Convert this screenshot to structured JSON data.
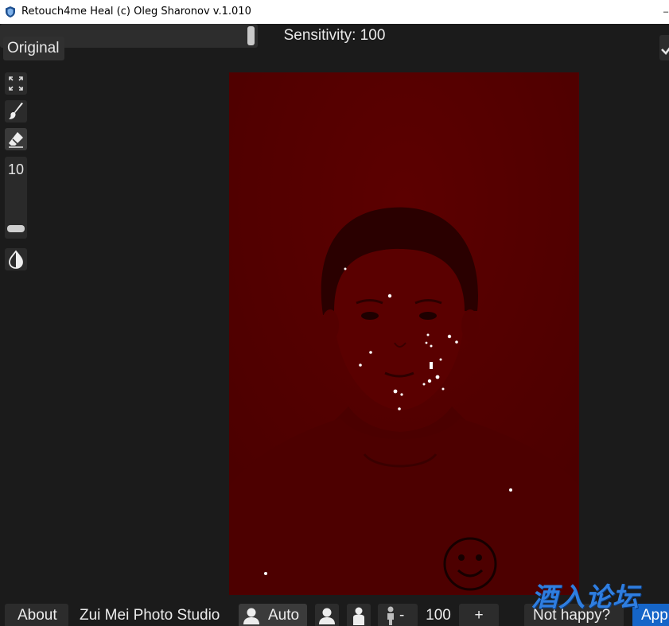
{
  "titlebar": {
    "title": "Retouch4me Heal (c) Oleg Sharonov v.1.010",
    "app_icon": "shield-icon"
  },
  "top": {
    "original_label": "Original",
    "sensitivity_label": "Sensitivity: 100",
    "sensitivity_value": 100,
    "confirm_icon": "check-icon"
  },
  "tools": {
    "fit_icon": "fit-to-screen-icon",
    "brush_icon": "brush-icon",
    "eraser_icon": "eraser-icon",
    "brush_size": "10",
    "mask_icon": "contrast-icon"
  },
  "colors": {
    "background": "#1b1b1b",
    "button": "#2c2c2c",
    "mask_tint": "#5a0000",
    "apply": "#1565c8",
    "watermark": "#2f7ee0"
  },
  "bottom": {
    "about_label": "About",
    "studio_label": "Zui Mei Photo Studio",
    "auto_label": "Auto",
    "person_minus_label": "-",
    "zoom_value": "100",
    "zoom_plus_label": "+",
    "not_happy_label": "Not happy?",
    "apply_label": "App"
  },
  "watermark": "酒入论坛"
}
